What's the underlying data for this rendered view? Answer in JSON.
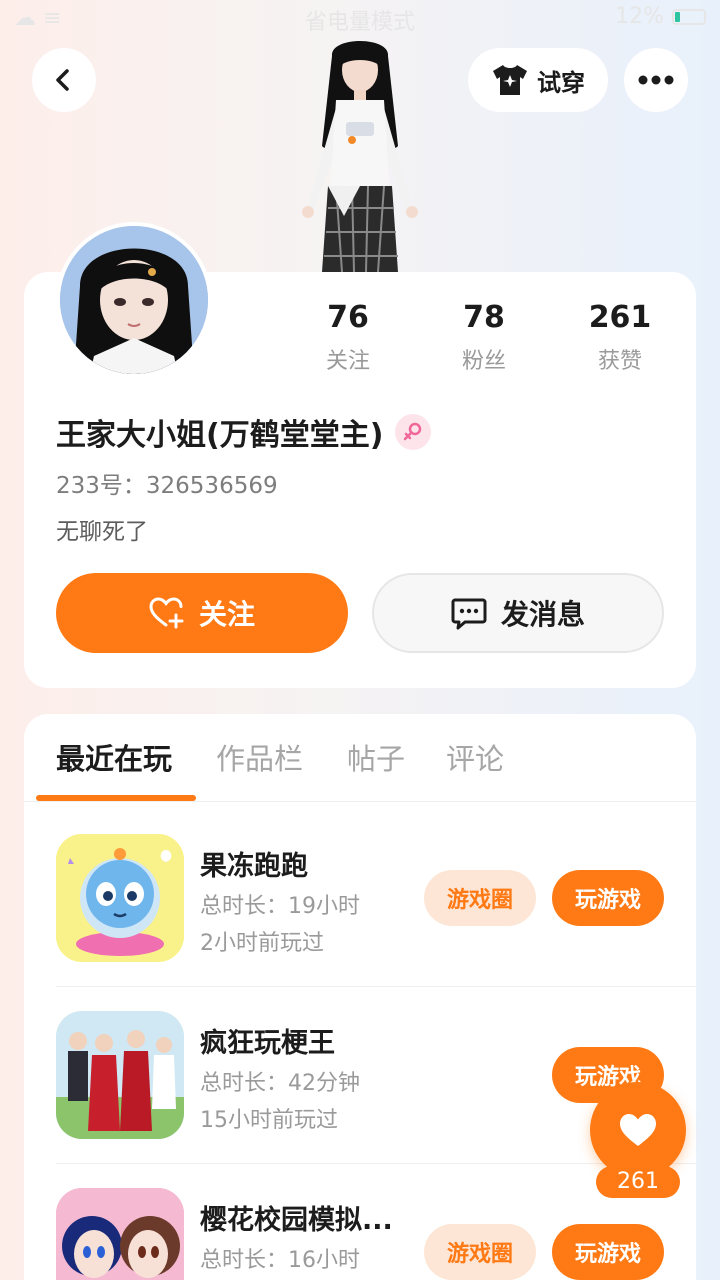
{
  "status_bar": {
    "left": "☁ ≡",
    "center": "省电量模式",
    "battery_text": "12%"
  },
  "header": {
    "try_on_label": "试穿"
  },
  "profile": {
    "stats": [
      {
        "value": "76",
        "label": "关注"
      },
      {
        "value": "78",
        "label": "粉丝"
      },
      {
        "value": "261",
        "label": "获赞"
      }
    ],
    "nickname": "王家大小姐(万鹤堂堂主)",
    "uid": "233号：326536569",
    "bio": "无聊死了",
    "follow_label": "关注",
    "message_label": "发消息"
  },
  "tabs": [
    {
      "label": "最近在玩"
    },
    {
      "label": "作品栏"
    },
    {
      "label": "帖子"
    },
    {
      "label": "评论"
    }
  ],
  "games": [
    {
      "title": "果冻跑跑",
      "duration": "总时长：19小时",
      "last_played": "2小时前玩过",
      "circle_label": "游戏圈",
      "play_label": "玩游戏"
    },
    {
      "title": "疯狂玩梗王",
      "duration": "总时长：42分钟",
      "last_played": "15小时前玩过",
      "play_label": "玩游戏"
    },
    {
      "title": "樱花校园模拟...",
      "duration": "总时长：16小时",
      "circle_label": "游戏圈",
      "play_label": "玩游戏"
    }
  ],
  "floating_like": {
    "count": "261"
  },
  "colors": {
    "accent": "#ff7a15",
    "accent_soft": "#fde6d6",
    "text_primary": "#1c1c1c",
    "text_secondary": "#9a9a9a"
  }
}
